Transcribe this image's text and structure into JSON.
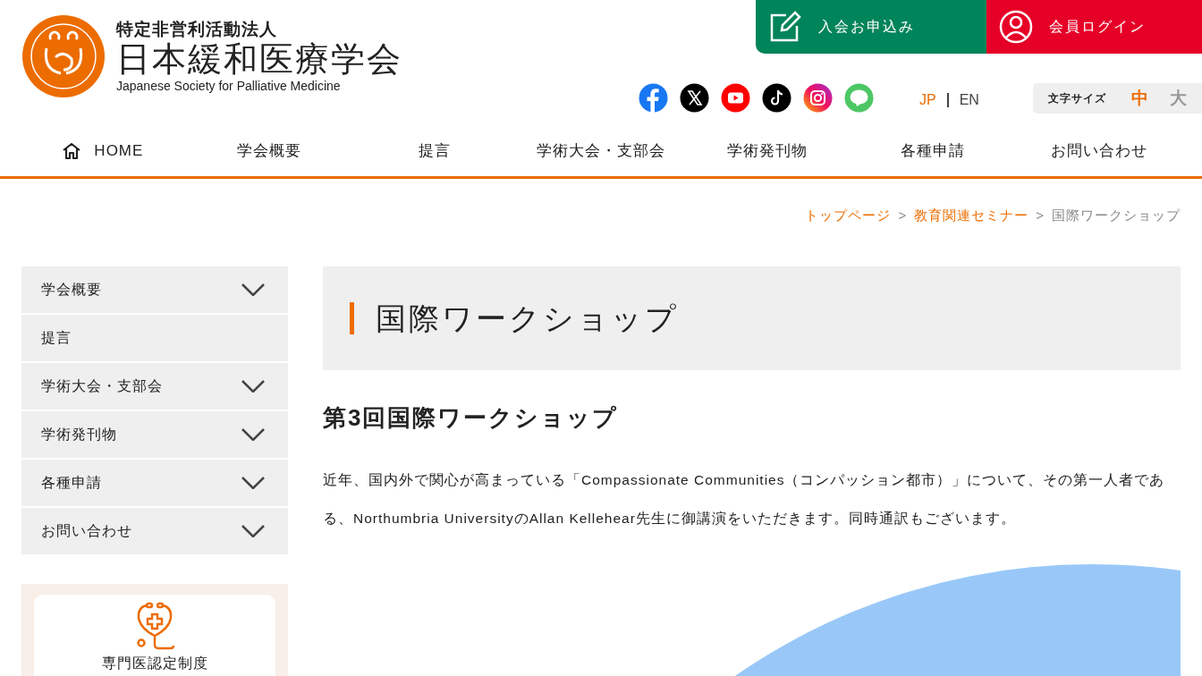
{
  "logo": {
    "subtitle": "特定非営利活動法人",
    "title": "日本緩和医療学会",
    "english": "Japanese Society for Palliative Medicine"
  },
  "header_buttons": [
    {
      "kind": "join",
      "label": "入会お申込み"
    },
    {
      "kind": "login",
      "label": "会員ログイン"
    }
  ],
  "social": [
    {
      "kind": "facebook"
    },
    {
      "kind": "x"
    },
    {
      "kind": "youtube"
    },
    {
      "kind": "tiktok"
    },
    {
      "kind": "instagram"
    },
    {
      "kind": "line"
    }
  ],
  "languages": [
    {
      "label": "JP",
      "selected": true
    },
    {
      "label": "EN",
      "selected": false
    }
  ],
  "font_size": {
    "label": "文字サイズ",
    "options": [
      {
        "label": "中",
        "selected": true
      },
      {
        "label": "大",
        "selected": false
      }
    ]
  },
  "nav": [
    {
      "label": "HOME",
      "kind": "home"
    },
    {
      "label": "学会概要",
      "kind": "page"
    },
    {
      "label": "提言",
      "kind": "page"
    },
    {
      "label": "学術大会・支部会",
      "kind": "page"
    },
    {
      "label": "学術発刊物",
      "kind": "page"
    },
    {
      "label": "各種申請",
      "kind": "page"
    },
    {
      "label": "お問い合わせ",
      "kind": "page"
    }
  ],
  "breadcrumb": [
    {
      "label": "トップページ",
      "link": true
    },
    {
      "label": "教育関連セミナー",
      "link": true
    },
    {
      "label": "国際ワークショップ",
      "link": false
    }
  ],
  "breadcrumb_separator": ">",
  "sidebar": {
    "items": [
      {
        "label": "学会概要",
        "expandable": true
      },
      {
        "label": "提言",
        "expandable": false
      },
      {
        "label": "学術大会・支部会",
        "expandable": true
      },
      {
        "label": "学術発刊物",
        "expandable": true
      },
      {
        "label": "各種申請",
        "expandable": true
      },
      {
        "label": "お問い合わせ",
        "expandable": true
      }
    ],
    "card": {
      "label": "専門医認定制度"
    }
  },
  "page_title": "国際ワークショップ",
  "section_title": "第3回国際ワークショップ",
  "paragraph": "近年、国内外で関心が高まっている「Compassionate Communities（コンパッション都市）」について、その第一人者である、Northumbria UniversityのAllan Kellehear先生に御講演をいただきます。同時通訳もございます。"
}
